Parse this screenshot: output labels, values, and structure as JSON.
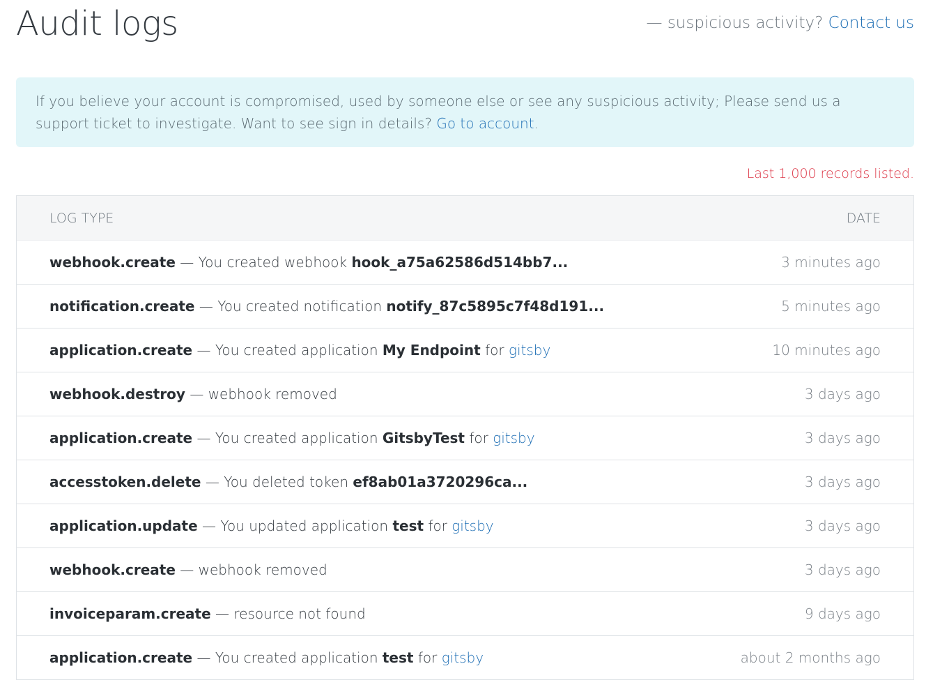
{
  "header": {
    "title": "Audit logs",
    "contact_prefix": "— suspicious activity?",
    "contact_link": "Contact us"
  },
  "alert": {
    "text": "If you believe your account is compromised, used by someone else or see any suspicious activity; Please send us a support ticket to investigate. Want to see sign in details?",
    "link": "Go to account",
    "suffix": "."
  },
  "records_note": "Last 1,000 records listed.",
  "table": {
    "columns": [
      "LOG TYPE",
      "DATE"
    ],
    "rows": [
      {
        "type": "webhook.create",
        "sep": "—",
        "text": "You created webhook",
        "resource": "hook_a75a62586d514bb7...",
        "for_text": "",
        "link": "",
        "date": "3 minutes ago"
      },
      {
        "type": "notification.create",
        "sep": "—",
        "text": "You created notification",
        "resource": "notify_87c5895c7f48d191...",
        "for_text": "",
        "link": "",
        "date": "5 minutes ago"
      },
      {
        "type": "application.create",
        "sep": "—",
        "text": "You created application",
        "resource": "My Endpoint",
        "for_text": "for",
        "link": "gitsby",
        "date": "10 minutes ago"
      },
      {
        "type": "webhook.destroy",
        "sep": "—",
        "text": "webhook removed",
        "resource": "",
        "for_text": "",
        "link": "",
        "date": "3 days ago"
      },
      {
        "type": "application.create",
        "sep": "—",
        "text": "You created application",
        "resource": "GitsbyTest",
        "for_text": "for",
        "link": "gitsby",
        "date": "3 days ago"
      },
      {
        "type": "accesstoken.delete",
        "sep": "—",
        "text": "You deleted token",
        "resource": "ef8ab01a3720296ca...",
        "for_text": "",
        "link": "",
        "date": "3 days ago"
      },
      {
        "type": "application.update",
        "sep": "—",
        "text": "You updated application",
        "resource": "test",
        "for_text": "for",
        "link": "gitsby",
        "date": "3 days ago"
      },
      {
        "type": "webhook.create",
        "sep": "—",
        "text": "webhook removed",
        "resource": "",
        "for_text": "",
        "link": "",
        "date": "3 days ago"
      },
      {
        "type": "invoiceparam.create",
        "sep": "—",
        "text": "resource not found",
        "resource": "",
        "for_text": "",
        "link": "",
        "date": "9 days ago"
      },
      {
        "type": "application.create",
        "sep": "—",
        "text": "You created application",
        "resource": "test",
        "for_text": "for",
        "link": "gitsby",
        "date": "about 2 months ago"
      }
    ]
  },
  "colors": {
    "link": "#1f6fb5",
    "alert_bg": "#e2f6f9",
    "records_note": "#dc3545"
  }
}
